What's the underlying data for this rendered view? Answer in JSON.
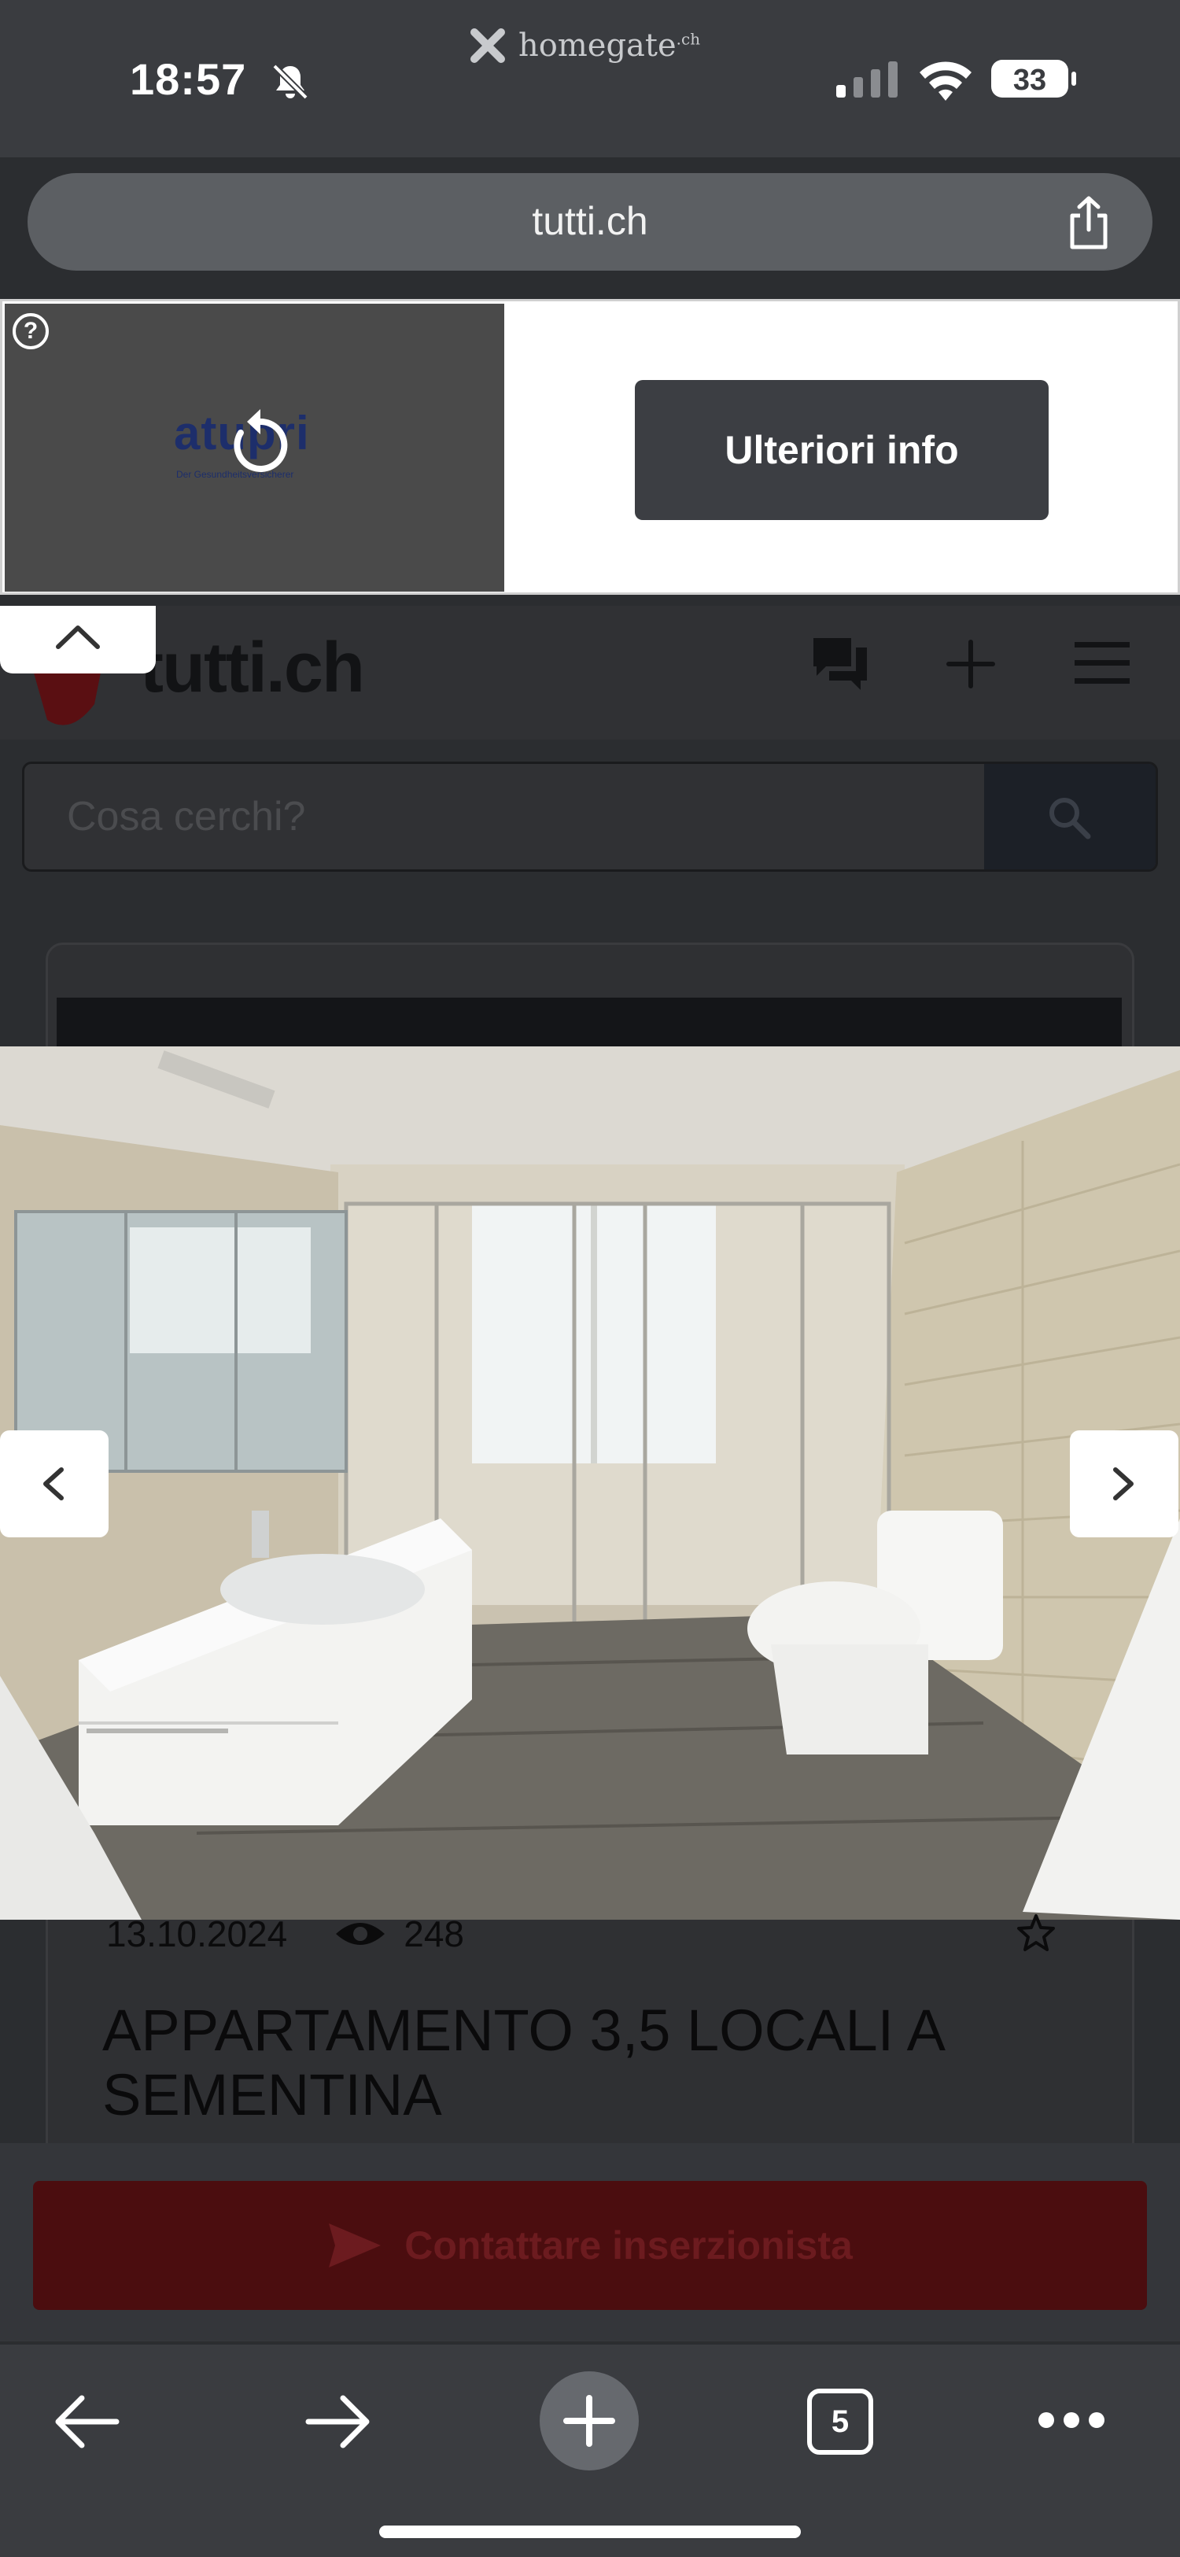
{
  "status_bar": {
    "time": "18:57",
    "notification_source": "homegate",
    "notification_source_tld": ".ch",
    "battery": "33"
  },
  "browser": {
    "url": "tutti.ch",
    "tab_count": "5"
  },
  "ad": {
    "logo_text": "atupri",
    "logo_subtext": "Der Gesundheitsversicherer",
    "cta_label": "Ulteriori info",
    "help_label": "?"
  },
  "site": {
    "logo_text": "tutti.ch",
    "search": {
      "placeholder": "Cosa cerchi?"
    }
  },
  "listing": {
    "date": "13.10.2024",
    "views": "248",
    "title": "APPARTAMENTO 3,5 LOCALI A SEMENTINA",
    "contact_label": "Contattare inserzionista"
  },
  "colors": {
    "dim_background": "#2b2d30",
    "contact_button": "#4b0d0f",
    "ad_cta": "#3c3e43"
  }
}
